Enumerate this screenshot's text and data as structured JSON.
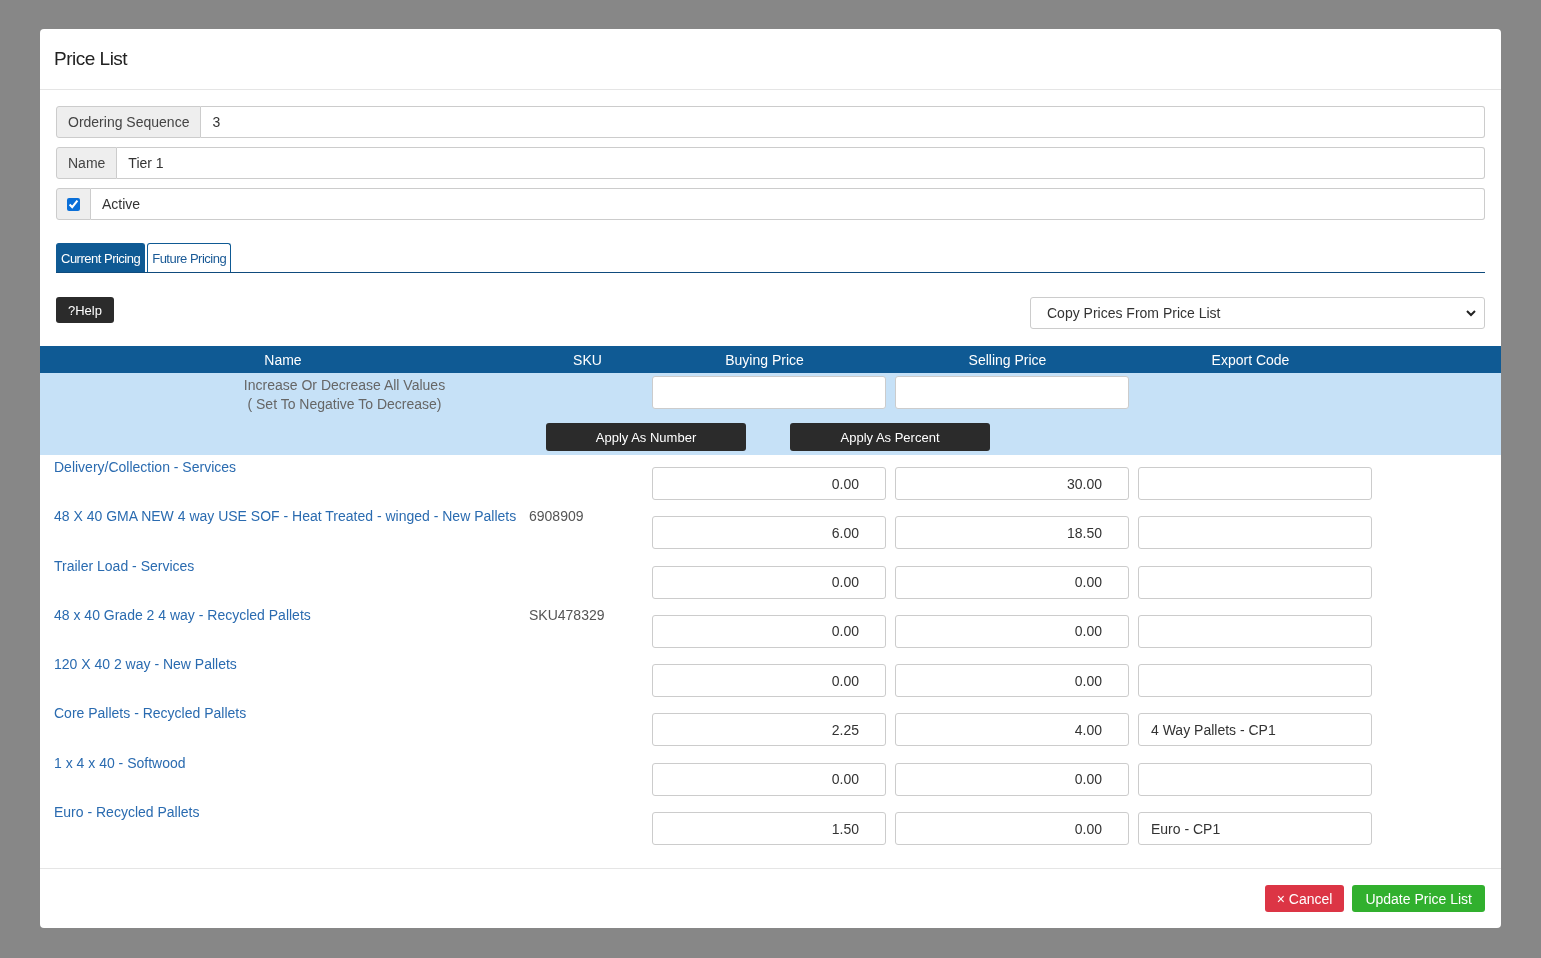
{
  "dialog": {
    "title": "Price List"
  },
  "fields": [
    {
      "kind": "text",
      "label": "Ordering Sequence",
      "value": "3"
    },
    {
      "kind": "text",
      "label": "Name",
      "value": "Tier 1"
    },
    {
      "kind": "checkbox",
      "label": "Active",
      "checked": true
    }
  ],
  "tabs": [
    {
      "label": "Current Pricing",
      "selected": true
    },
    {
      "label": "Future Pricing",
      "selected": false
    }
  ],
  "help_button": "?Help",
  "copy_select": {
    "value": "Copy Prices From Price List"
  },
  "table": {
    "columns": [
      "Name",
      "SKU",
      "Buying Price",
      "Selling Price",
      "Export Code"
    ],
    "adjust": {
      "label_lines": [
        "Increase Or Decrease All Values",
        "( Set To Negative To Decrease)"
      ],
      "buttons": [
        "Apply As Number",
        "Apply As Percent"
      ]
    },
    "rows": [
      {
        "name": "Delivery/Collection - Services",
        "sku": "",
        "buying": "0.00",
        "selling": "30.00",
        "export": ""
      },
      {
        "name": "48 X 40 GMA NEW 4 way USE SOF - Heat Treated - winged - New Pallets",
        "sku": "6908909",
        "buying": "6.00",
        "selling": "18.50",
        "export": ""
      },
      {
        "name": "Trailer Load - Services",
        "sku": "",
        "buying": "0.00",
        "selling": "0.00",
        "export": ""
      },
      {
        "name": "48 x 40 Grade 2 4 way - Recycled Pallets",
        "sku": "SKU478329",
        "buying": "0.00",
        "selling": "0.00",
        "export": ""
      },
      {
        "name": "120 X 40 2 way - New Pallets",
        "sku": "",
        "buying": "0.00",
        "selling": "0.00",
        "export": ""
      },
      {
        "name": "Core Pallets - Recycled Pallets",
        "sku": "",
        "buying": "2.25",
        "selling": "4.00",
        "export": "4 Way Pallets - CP1"
      },
      {
        "name": "1 x 4 x 40 - Softwood",
        "sku": "",
        "buying": "0.00",
        "selling": "0.00",
        "export": ""
      },
      {
        "name": "Euro - Recycled Pallets",
        "sku": "",
        "buying": "1.50",
        "selling": "0.00",
        "export": "Euro - CP1"
      }
    ]
  },
  "footer": {
    "cancel": "× Cancel",
    "submit": "Update Price List"
  }
}
